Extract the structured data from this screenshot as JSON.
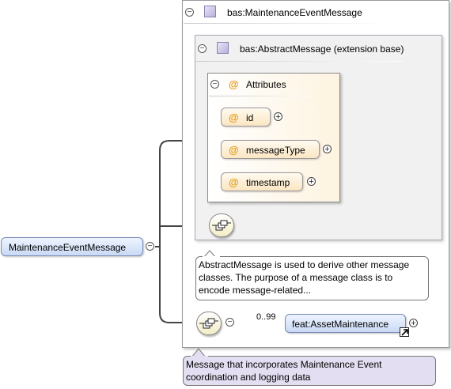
{
  "outer_type": {
    "label": "bas:MaintenanceEventMessage"
  },
  "extension": {
    "label": "bas:AbstractMessage (extension base)"
  },
  "attributes_group": {
    "label": "Attributes",
    "items": [
      {
        "label": "id"
      },
      {
        "label": "messageType"
      },
      {
        "label": "timestamp"
      }
    ]
  },
  "root_element": {
    "label": "MaintenanceEventMessage"
  },
  "abstract_doc": "AbstractMessage is used to derive other message classes. The purpose of a message class is to encode message-related...",
  "child_element": {
    "label": "feat:AssetMaintenance",
    "cardinality": "0..99"
  },
  "root_doc": "Message that incorporates Maintenance Event coordination and logging data",
  "icons": {
    "at": "@",
    "collapse": "⊖",
    "expand": "+",
    "minus": "−",
    "sequence": "sequence-compositor-icon",
    "complex_type": "complex-type-icon",
    "reference": "reference-arrow-icon"
  }
}
